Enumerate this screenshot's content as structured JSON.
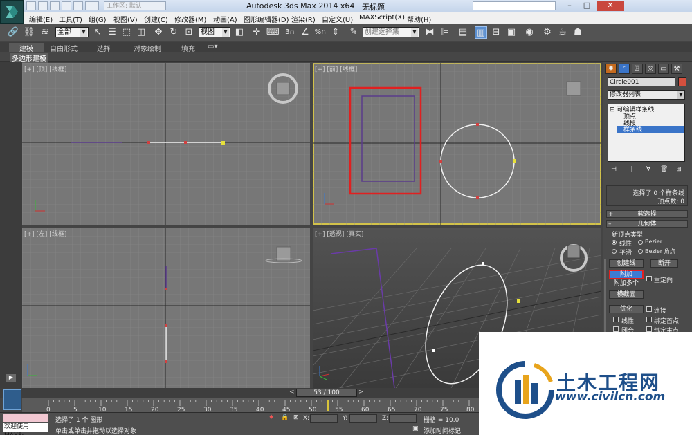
{
  "title_bar": {
    "app_title": "Autodesk 3ds Max  2014 x64",
    "document_title": "无标题",
    "workspace_text": "工作区: 默认"
  },
  "menu_bar": [
    "编辑(E)",
    "工具(T)",
    "组(G)",
    "视图(V)",
    "创建(C)",
    "修改器(M)",
    "动画(A)",
    "图形编辑器(D)",
    "渲染(R)",
    "自定义(U)",
    "MAXScript(X)",
    "帮助(H)"
  ],
  "toolbar": {
    "selection_filter": "全部",
    "reference_coord": "视图",
    "named_selection_placeholder": "创建选择集",
    "snap_value": "3",
    "percent_label": "%"
  },
  "ribbon": {
    "tabs": [
      "建模",
      "自由形式",
      "选择",
      "对象绘制",
      "填充"
    ],
    "active_tab": "建模",
    "sub_label": "多边形建模"
  },
  "viewports": {
    "top": "[+] [顶] [线框]",
    "front": "[+] [前] [线框]",
    "left": "[+] [左] [线框]",
    "perspective": "[+] [透视] [真实]"
  },
  "command_panel": {
    "object_name": "Circle001",
    "object_color": "#d4503e",
    "modifier_list": "修改器列表",
    "stack": {
      "root": "可编辑样条线",
      "items": [
        "顶点",
        "线段",
        "样条线"
      ],
      "selected": "样条线"
    },
    "selection": {
      "status_line1": "选择了 0 个样条线",
      "status_line2": "顶点数: 0"
    },
    "rollouts": {
      "soft_selection": "软选择",
      "geometry": "几何体"
    },
    "new_vertex_type": {
      "label": "新顶点类型",
      "options": [
        "线性",
        "Bezier",
        "平滑",
        "Bezier 角点"
      ],
      "selected": "线性"
    },
    "buttons": {
      "create_line": "创建线",
      "break": "断开",
      "attach": "附加",
      "reorient": "重定向",
      "attach_multiple": "附加多个",
      "cross_section": "横截面",
      "refine": "优化",
      "connect": "连接",
      "linear": "线性",
      "bind_first": "绑定首点",
      "closed": "闭合",
      "bind_last": "绑定末点"
    }
  },
  "timeline": {
    "slider_text": "53 / 100",
    "ticks": [
      "0",
      "5",
      "10",
      "15",
      "20",
      "25",
      "30",
      "35",
      "40",
      "45",
      "50",
      "55",
      "60",
      "65",
      "70",
      "75",
      "80"
    ]
  },
  "status_bar": {
    "maxscript": "欢迎使用 MAXSc",
    "selection_text": "选择了 1 个 图形",
    "prompt_text": "单击或单击并拖动以选择对象",
    "x_label": "X:",
    "y_label": "Y:",
    "z_label": "Z:",
    "grid_text": "栅格 = 10.0",
    "add_time_tag": "添加时间标记"
  },
  "watermark": {
    "brand": "土木工程网",
    "url": "www.civilcn.com"
  }
}
